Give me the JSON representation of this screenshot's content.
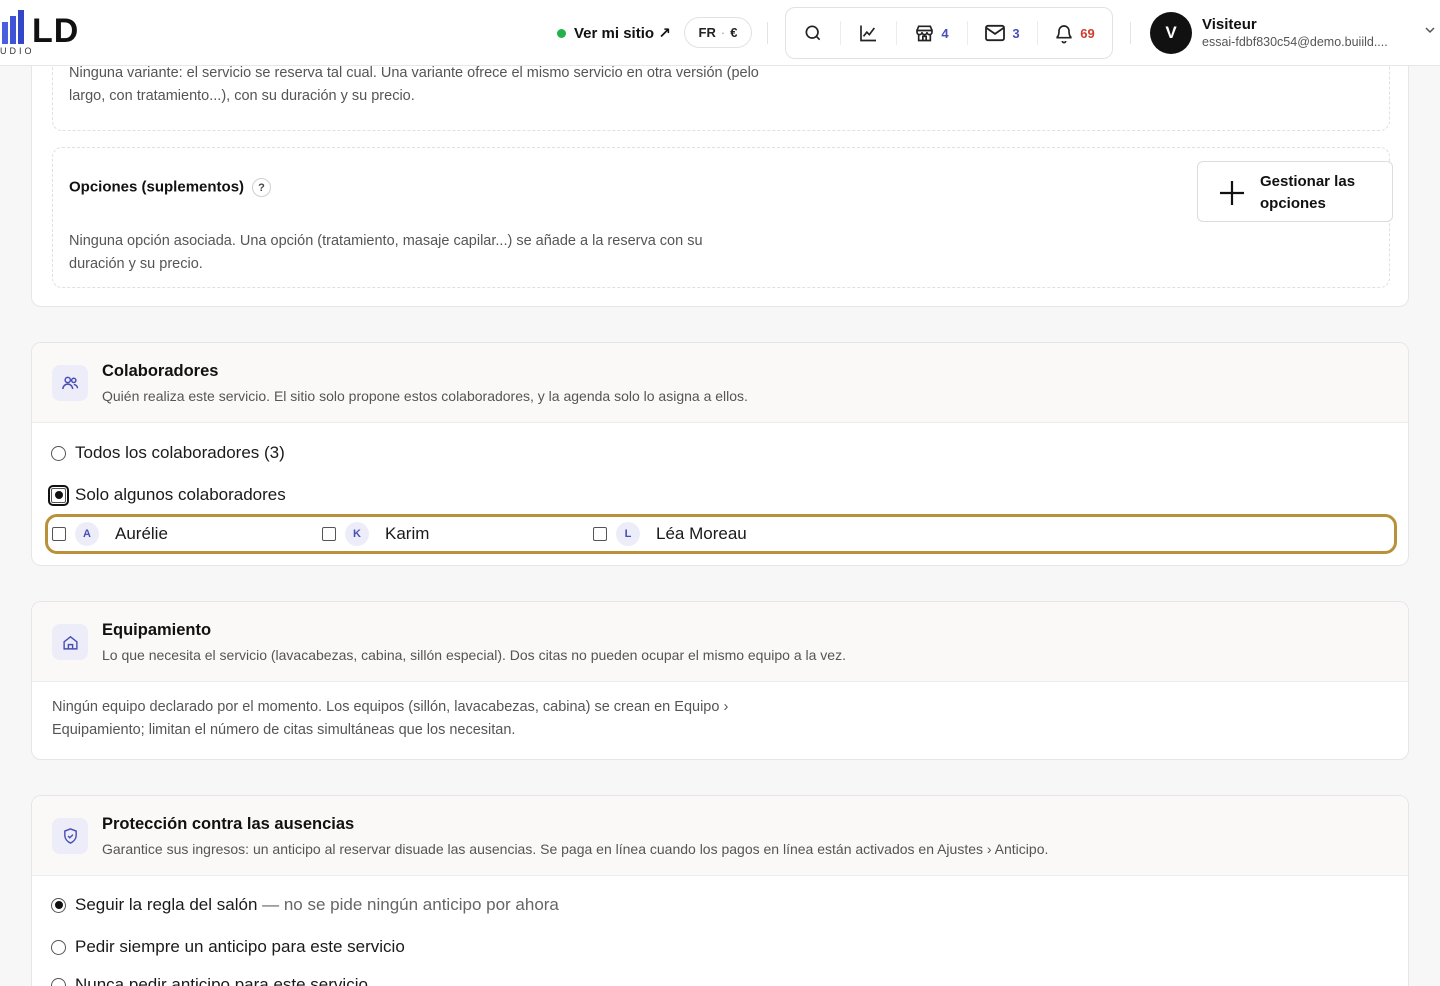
{
  "header": {
    "logo_text": "LD",
    "logo_sub": "UDIO",
    "site_link": "Ver mi sitio ↗",
    "lang": "FR",
    "currency": "€",
    "tools": [
      {
        "icon": "search-icon",
        "count": ""
      },
      {
        "icon": "chart-icon",
        "count": ""
      },
      {
        "icon": "store-icon",
        "count": "4",
        "color": "#4a4fb5"
      },
      {
        "icon": "mail-icon",
        "count": "3",
        "color": "#4a4fb5"
      },
      {
        "icon": "bell-icon",
        "count": "69",
        "color": "#d23c2e"
      }
    ],
    "user": {
      "initial": "V",
      "name": "Visiteur",
      "email": "essai-fdbf830c54@demo.buiild...."
    }
  },
  "variants": {
    "text": "Ninguna variante: el servicio se reserva tal cual. Una variante ofrece el mismo servicio en otra versión (pelo largo, con tratamiento...), con su duración y su precio."
  },
  "options": {
    "title": "Opciones (suplementos)",
    "help": "?",
    "text": "Ninguna opción asociada. Una opción (tratamiento, masaje capilar...) se añade a la reserva con su duración y su precio.",
    "button": "Gestionar las opciones"
  },
  "collaborators": {
    "title": "Colaboradores",
    "description": "Quién realiza este servicio. El sitio solo propone estos colaboradores, y la agenda solo lo asigna a ellos.",
    "option_all": "Todos los colaboradores (3)",
    "option_some": "Solo algunos colaboradores",
    "people": [
      {
        "initial": "A",
        "name": "Aurélie"
      },
      {
        "initial": "K",
        "name": "Karim"
      },
      {
        "initial": "L",
        "name": "Léa Moreau"
      }
    ]
  },
  "equipment": {
    "title": "Equipamiento",
    "description": "Lo que necesita el servicio (lavacabezas, cabina, sillón especial). Dos citas no pueden ocupar el mismo equipo a la vez.",
    "text": "Ningún equipo declarado por el momento. Los equipos (sillón, lavacabezas, cabina) se crean en Equipo › Equipamiento; limitan el número de citas simultáneas que los necesitan."
  },
  "protection": {
    "title": "Protección contra las ausencias",
    "description": "Garantice sus ingresos: un anticipo al reservar disuade las ausencias. Se paga en línea cuando los pagos en línea están activados en Ajustes › Anticipo.",
    "option_rule": "Seguir la regla del salón",
    "option_rule_hint": " — no se pide ningún anticipo por ahora",
    "option_always": "Pedir siempre un anticipo para este servicio",
    "option_never": "Nunca pedir anticipo para este servicio"
  },
  "colors": {
    "accent": "#4a4fb5",
    "focus_ring": "#b8913a",
    "alert": "#d23c2e",
    "online": "#22b14c"
  }
}
